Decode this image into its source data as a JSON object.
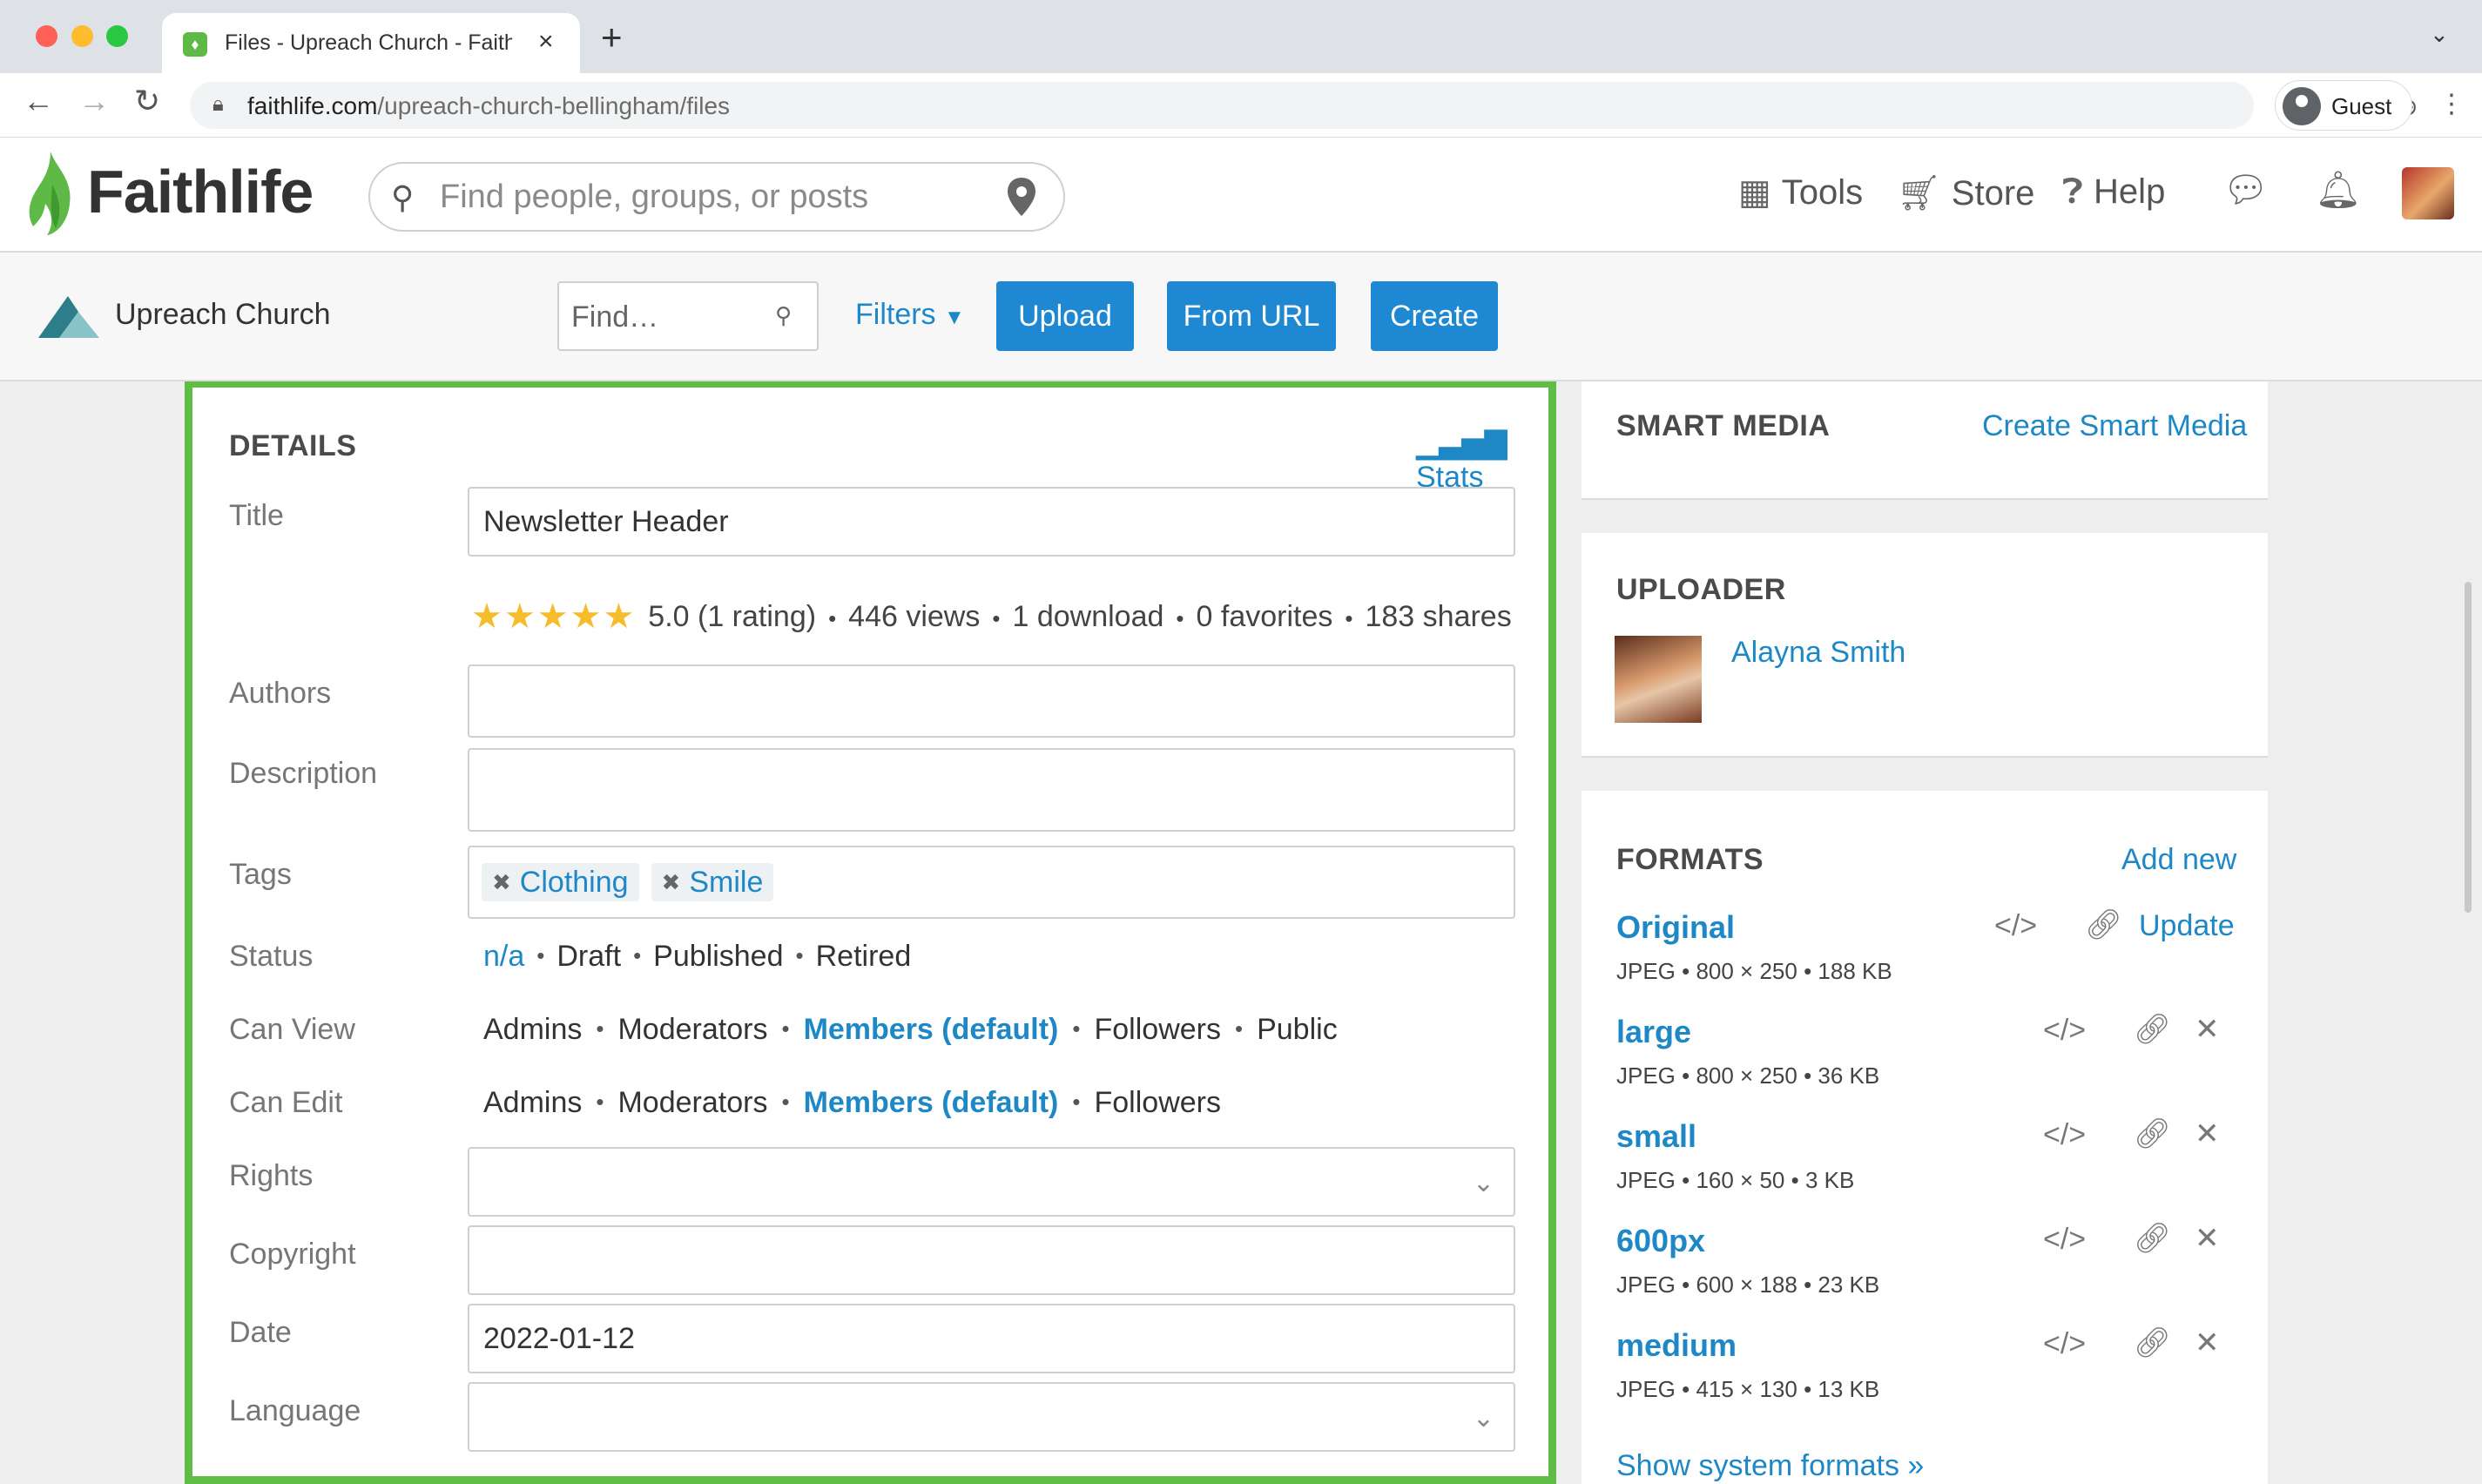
{
  "browser": {
    "tab_title": "Files - Upreach Church - Faithlife",
    "url_domain": "faithlife.com",
    "url_path": "/upreach-church-bellingham/files",
    "profile_name": "Guest"
  },
  "header": {
    "logo": "Faithlife",
    "search_placeholder": "Find people, groups, or posts",
    "nav": [
      "Tools",
      "Store",
      "Help"
    ]
  },
  "group_bar": {
    "name": "Upreach Church",
    "find_placeholder": "Find…",
    "filters_label": "Filters",
    "upload_label": "Upload",
    "from_url_label": "From URL",
    "create_label": "Create"
  },
  "details": {
    "title": "DETAILS",
    "stats_label": "Stats",
    "labels": {
      "title": "Title",
      "authors": "Authors",
      "description": "Description",
      "tags": "Tags",
      "status": "Status",
      "can_view": "Can View",
      "can_edit": "Can Edit",
      "rights": "Rights",
      "copyright": "Copyright",
      "date": "Date",
      "language": "Language"
    },
    "title_value": "Newsletter Header",
    "rating": {
      "stars": 5,
      "summary": "5.0 (1 rating)",
      "views": "446 views",
      "downloads": "1 download",
      "favorites": "0 favorites",
      "shares": "183 shares"
    },
    "tags": [
      "Clothing",
      "Smile"
    ],
    "status_options": [
      "n/a",
      "Draft",
      "Published",
      "Retired"
    ],
    "can_view_options": [
      "Admins",
      "Moderators",
      "Members (default)",
      "Followers",
      "Public"
    ],
    "can_edit_options": [
      "Admins",
      "Moderators",
      "Members (default)",
      "Followers"
    ],
    "date_value": "2022-01-12"
  },
  "smart_media": {
    "title": "SMART MEDIA",
    "link": "Create Smart Media"
  },
  "uploader": {
    "title": "UPLOADER",
    "name": "Alayna Smith"
  },
  "formats": {
    "title": "FORMATS",
    "add_label": "Add new",
    "update_label": "Update",
    "items": [
      {
        "name": "Original",
        "meta": "JPEG • 800 × 250 • 188 KB"
      },
      {
        "name": "large",
        "meta": "JPEG • 800 × 250 • 36 KB"
      },
      {
        "name": "small",
        "meta": "JPEG • 160 × 50 • 3 KB"
      },
      {
        "name": "600px",
        "meta": "JPEG • 600 × 188 • 23 KB"
      },
      {
        "name": "medium",
        "meta": "JPEG • 415 × 130 • 13 KB"
      }
    ],
    "show_system": "Show system formats »"
  },
  "colors": {
    "accent_blue": "#1e88c7",
    "button_blue": "#1e88d3",
    "highlight_green": "#5fbd46",
    "star_gold": "#f5bd2a"
  }
}
